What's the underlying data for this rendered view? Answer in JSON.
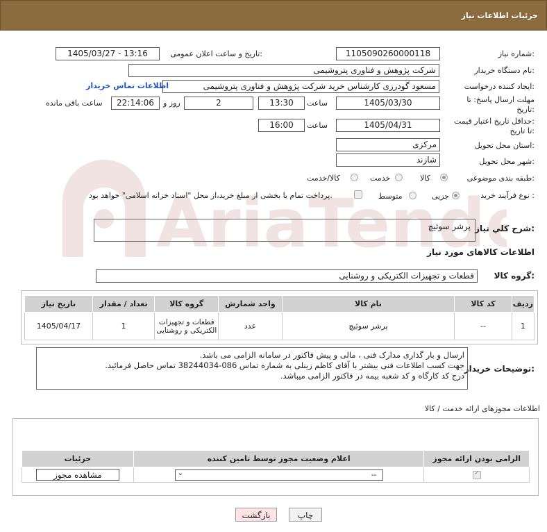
{
  "header": {
    "title": "جزئیات اطلاعات نیاز"
  },
  "fields": {
    "need_number_label": "شماره نیاز:",
    "need_number": "1105090260000118",
    "announce_label": "تاریخ و ساعت اعلان عمومی:",
    "announce_value": "1405/03/27 - 13:16",
    "buyer_org_label": "نام دستگاه خریدار:",
    "buyer_org": "شرکت پژوهش و فناوری پتروشیمی",
    "requester_label": "ایجاد کننده درخواست:",
    "requester": "مسعود گودرزی کارشناس خرید شرکت پژوهش و فناوری پتروشیمی",
    "buyer_contact_link": "اطلاعات تماس خریدار",
    "deadline_label_1": "مهلت ارسال پاسخ: تا",
    "deadline_label_2": "تاریخ:",
    "deadline_date": "1405/03/30",
    "time_label": "ساعت",
    "deadline_time": "13:30",
    "days_value": "2",
    "days_label": "روز و",
    "remaining_time": "22:14:06",
    "remaining_label": "ساعت باقی مانده",
    "validity_label_1": "حداقل تاریخ اعتبار قیمت:",
    "validity_label_2": "تا تاریخ:",
    "validity_date": "1405/04/31",
    "validity_time": "16:00",
    "province_label": "استان محل تحویل:",
    "province": "مرکزی",
    "city_label": "شهر محل تحویل:",
    "city": "شازند",
    "category_label": "طبقه بندی موضوعی:",
    "category_options": [
      "کالا",
      "خدمت",
      "کالا/خدمت"
    ],
    "process_label": "نوع فرآیند خرید :",
    "process_options": [
      "جزیی",
      "متوسط"
    ],
    "payment_note": "پرداخت تمام یا بخشی از مبلغ خرید،از محل \"اسناد خزانه اسلامی\" خواهد بود."
  },
  "description": {
    "label": "شرح کلي نياز:",
    "value": "پرشر سوئیچ"
  },
  "goods": {
    "section_title": "اطلاعات کالاهای مورد نیاز",
    "group_label": "گروه کالا:",
    "group_value": "قطعات و تجهیزات الکتریکی و روشنایی",
    "columns": [
      "ردیف",
      "کد کالا",
      "نام کالا",
      "واحد شمارش",
      "گروه کالا",
      "تعداد / مقدار",
      "تاریخ نیاز"
    ],
    "rows": [
      [
        "1",
        "--",
        "پرشر سوئیچ",
        "عدد",
        "قطعات و تجهیزات الکتریکی و روشنایی",
        "1",
        "1405/04/17"
      ]
    ]
  },
  "buyer_notes": {
    "label": "توضیحات خریدار:",
    "lines": [
      "ارسال و بار گذاری مدارک فنی ، مالی و پیش فاکتور در سامانه الزامی می باشد.",
      "جهت کسب اطلاعات فنی بیشتر با آقای کاظم زینلی به شماره تماس 086-38244034 تماس حاصل فرمائید.",
      "درج کد کارگاه و کد شعبه بیمه  در فاکتور الزامی میباشد."
    ]
  },
  "permits": {
    "section_title": "اطلاعات مجوزهای ارائه خدمت / کالا",
    "columns": [
      "الزامی بودن ارائه مجوز",
      "اعلام وضعیت مجوز توسط تامین کننده",
      "جزئیات"
    ],
    "select_value": "--",
    "view_button": "مشاهده مجوز"
  },
  "buttons": {
    "print": "چاپ",
    "back": "بازگشت"
  },
  "watermark": {
    "text": "AriaTender.neT"
  },
  "colors": {
    "header_bg": "#8b6a3e",
    "link": "#1f55c8",
    "table_head": "#d2d2d2",
    "back_btn_bg": "#fde3e3"
  }
}
